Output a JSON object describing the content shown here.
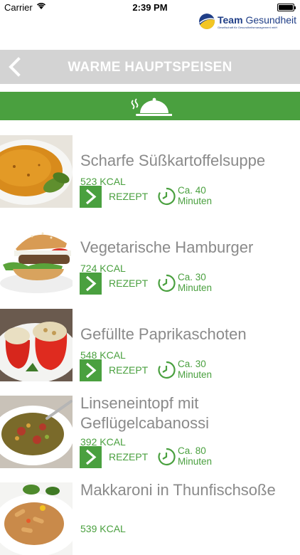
{
  "status_bar": {
    "carrier": "Carrier",
    "time": "2:39 PM"
  },
  "brand": {
    "name_bold": "Team",
    "name_light": "Gesundheit",
    "tagline": "Gesellschaft für Gesundheitsmanagement mbH"
  },
  "navbar": {
    "title": "WARME HAUPTSPEISEN"
  },
  "category": {
    "icon": "cloche-icon"
  },
  "colors": {
    "accent": "#4aa03f",
    "navbar": "#d3d3d3",
    "text_gray": "#8a8a8a",
    "brand_blue": "#1f3e87",
    "brand_yellow": "#f3c623"
  },
  "recipes": [
    {
      "name": "Scharfe Süßkartoffelsuppe",
      "kcal": "523 KCAL",
      "rezept": "REZEPT",
      "time_line1": "Ca. 40",
      "time_line2": "Minuten"
    },
    {
      "name": "Vegetarische Hamburger",
      "kcal": "724 KCAL",
      "rezept": "REZEPT",
      "time_line1": "Ca. 30",
      "time_line2": "Minuten"
    },
    {
      "name": "Gefüllte Paprikaschoten",
      "kcal": "548 KCAL",
      "rezept": "REZEPT",
      "time_line1": "Ca. 30",
      "time_line2": "Minuten"
    },
    {
      "name": "Linseneintopf mit Geflügelcabanossi",
      "kcal": "392 KCAL",
      "rezept": "REZEPT",
      "time_line1": "Ca. 80",
      "time_line2": "Minuten"
    },
    {
      "name": "Makkaroni in Thunfischsoße",
      "kcal": "539 KCAL",
      "rezept": "",
      "time_line1": "",
      "time_line2": ""
    }
  ]
}
